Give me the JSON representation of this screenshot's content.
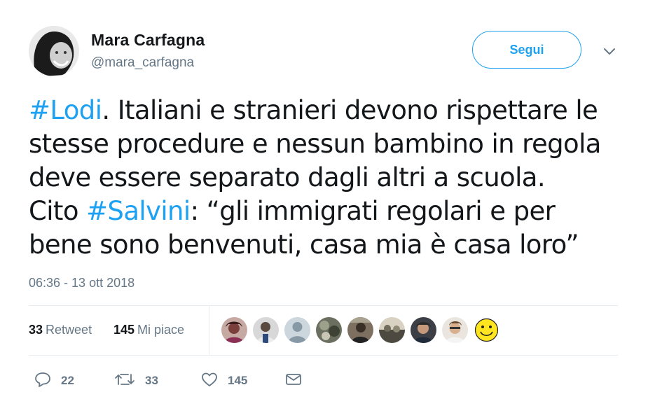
{
  "author": {
    "name": "Mara Carfagna",
    "handle": "@mara_carfagna"
  },
  "follow_label": "Segui",
  "tweet": {
    "line1_hashtag": "#Lodi",
    "line1_rest": ". Italiani e stranieri devono rispettare le",
    "line2": "stesse procedure e nessun bambino in regola",
    "line3": "deve essere separato dagli altri a scuola.",
    "line4_prefix": "Cito ",
    "line4_hashtag": "#Salvini",
    "line4_rest": ": “gli immigrati regolari e per",
    "line5": "bene sono benvenuti, casa mia è casa loro”"
  },
  "timestamp": "06:36 - 13 ott 2018",
  "stats": {
    "retweets_count": "33",
    "retweets_label": "Retweet",
    "likes_count": "145",
    "likes_label": "Mi piace"
  },
  "actions": {
    "replies": "22",
    "retweets": "33",
    "likes": "145"
  },
  "colors": {
    "accent": "#1da1f2",
    "secondary_text": "#657786",
    "divider": "#e6ecf0"
  },
  "icons": [
    "chevron-down-icon",
    "reply-icon",
    "retweet-icon",
    "heart-icon",
    "dm-envelope-icon"
  ]
}
